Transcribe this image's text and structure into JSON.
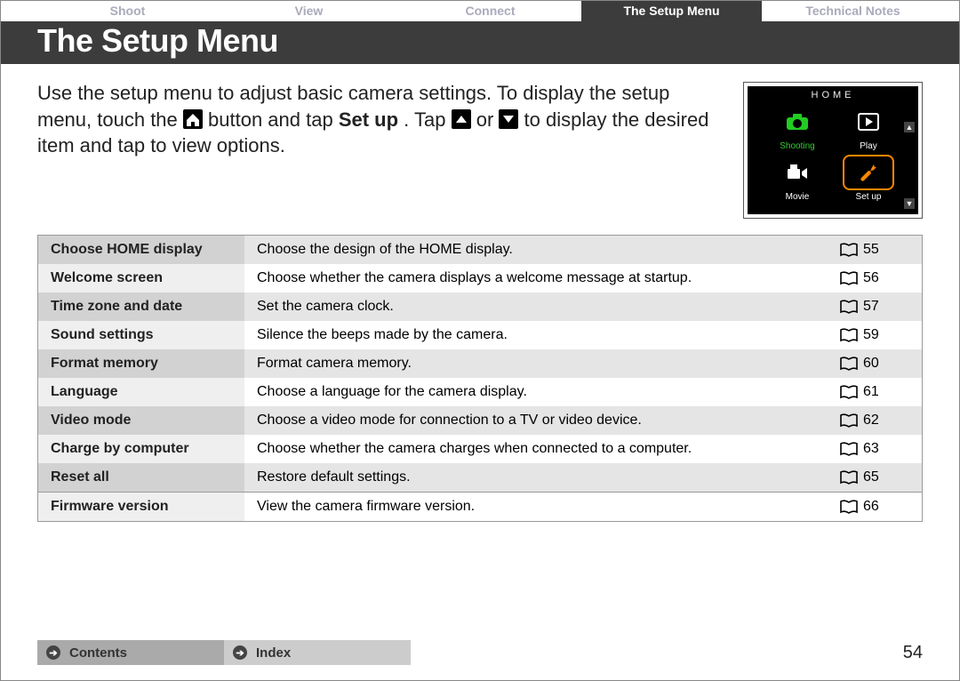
{
  "tabs": [
    "Shoot",
    "View",
    "Connect",
    "The Setup Menu",
    "Technical Notes"
  ],
  "activeTab": 3,
  "title": "The Setup Menu",
  "intro": {
    "p1a": "Use the setup menu to adjust basic camera settings. To display the setup menu, touch the ",
    "p1b": " button and tap ",
    "setup_word": "Set up",
    "p1c": ". Tap ",
    "or": " or ",
    "p1d": " to display the desired item and tap to view options."
  },
  "thumb": {
    "title": "HOME",
    "shooting": "Shooting",
    "play": "Play",
    "movie": "Movie",
    "setup": "Set up"
  },
  "rows": [
    {
      "label": "Choose HOME display",
      "desc": "Choose the design of the HOME display.",
      "page": "55"
    },
    {
      "label": "Welcome screen",
      "desc": "Choose whether the camera displays a welcome message at startup.",
      "page": "56"
    },
    {
      "label": "Time zone and date",
      "desc": "Set the camera clock.",
      "page": "57"
    },
    {
      "label": "Sound settings",
      "desc": "Silence the beeps made by the camera.",
      "page": "59"
    },
    {
      "label": "Format memory",
      "desc": "Format camera memory.",
      "page": "60"
    },
    {
      "label": "Language",
      "desc": "Choose a language for the camera display.",
      "page": "61"
    },
    {
      "label": "Video mode",
      "desc": "Choose a video mode for connection to a TV or video device.",
      "page": "62"
    },
    {
      "label": "Charge by computer",
      "desc": "Choose whether the camera charges when connected to a computer.",
      "page": "63"
    },
    {
      "label": "Reset all",
      "desc": "Restore default settings.",
      "page": "65"
    },
    {
      "label": "Firmware version",
      "desc": "View the camera firmware version.",
      "page": "66"
    }
  ],
  "footer": {
    "contents": "Contents",
    "index": "Index",
    "page": "54"
  }
}
